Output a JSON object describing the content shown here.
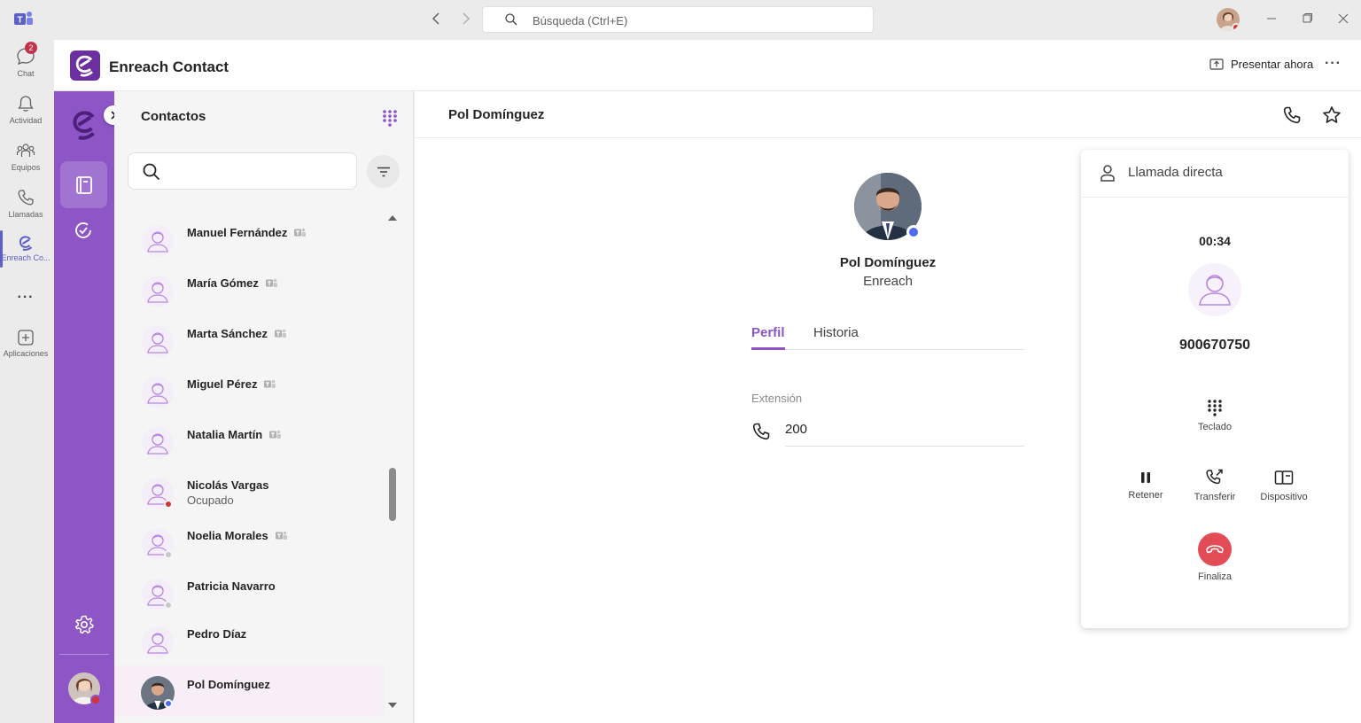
{
  "titlebar": {
    "search_placeholder": "Búsqueda (Ctrl+E)"
  },
  "rail": {
    "items": [
      {
        "label": "Chat",
        "icon": "chat-icon",
        "badge": "2"
      },
      {
        "label": "Actividad",
        "icon": "bell-icon"
      },
      {
        "label": "Equipos",
        "icon": "teams-icon"
      },
      {
        "label": "Llamadas",
        "icon": "phone-icon"
      },
      {
        "label": "Enreach Co...",
        "icon": "enreach-icon"
      },
      {
        "label": "Aplicaciones",
        "icon": "add-apps-icon"
      }
    ]
  },
  "app": {
    "title": "Enreach Contact",
    "present_label": "Presentar ahora",
    "accent": "#8d55c5"
  },
  "contacts": {
    "title": "Contactos",
    "items": [
      {
        "name": "Manuel Fernández",
        "sub": "",
        "status": "",
        "teams": true
      },
      {
        "name": "María Gómez",
        "sub": "",
        "status": "",
        "teams": true
      },
      {
        "name": "Marta Sánchez",
        "sub": "",
        "status": "",
        "teams": true
      },
      {
        "name": "Miguel Pérez",
        "sub": "",
        "status": "",
        "teams": true
      },
      {
        "name": "Natalia Martín",
        "sub": "",
        "status": "",
        "teams": true
      },
      {
        "name": "Nicolás Vargas",
        "sub": "Ocupado",
        "status": "#d13438",
        "teams": false
      },
      {
        "name": "Noelia Morales",
        "sub": "",
        "status": "#c8c8c8",
        "teams": true
      },
      {
        "name": "Patricia Navarro",
        "sub": "",
        "status": "#c8c8c8",
        "teams": false
      },
      {
        "name": "Pedro Díaz",
        "sub": "",
        "status": "",
        "teams": false
      },
      {
        "name": "Pol Domínguez",
        "sub": "",
        "status": "#4f6bed",
        "teams": false,
        "photo": true
      }
    ]
  },
  "detail": {
    "name": "Pol Domínguez",
    "company": "Enreach",
    "tabs": [
      "Perfil",
      "Historia"
    ],
    "extension_label": "Extensión",
    "extension_value": "200"
  },
  "call": {
    "title": "Llamada directa",
    "timer": "00:34",
    "number": "900670750",
    "keypad_label": "Teclado",
    "hold_label": "Retener",
    "transfer_label": "Transferir",
    "device_label": "Dispositivo",
    "end_label": "Finaliza",
    "end_color": "#e34c56"
  }
}
